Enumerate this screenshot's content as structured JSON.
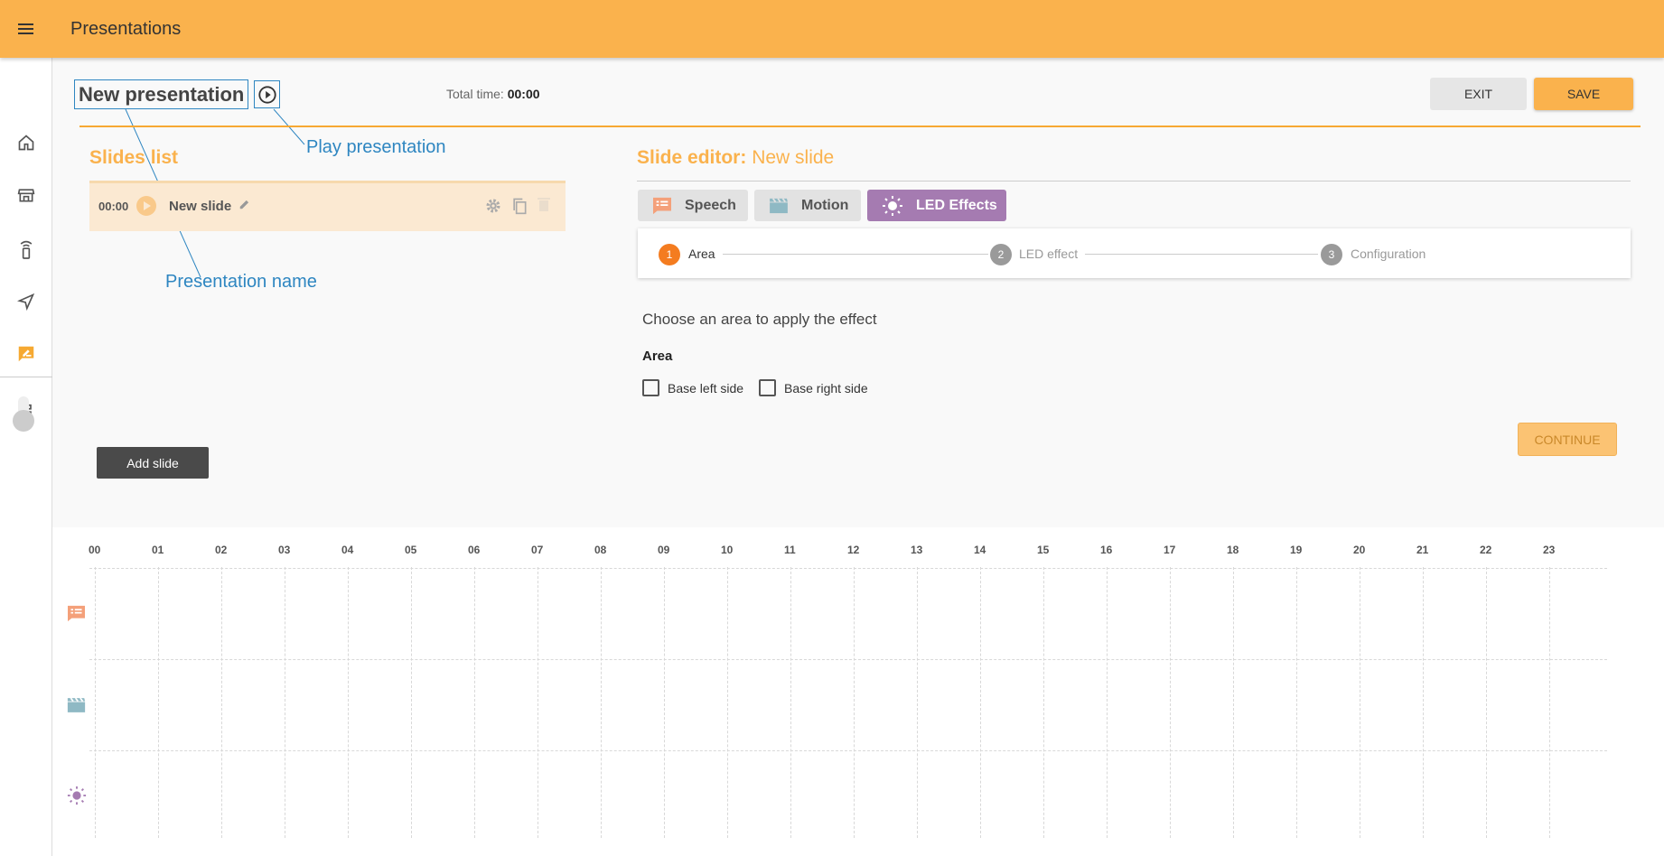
{
  "app": {
    "title": "Presentations"
  },
  "sidebar": {
    "items": [
      {
        "name": "home",
        "icon": "home-icon"
      },
      {
        "name": "store",
        "icon": "store-icon"
      },
      {
        "name": "remote",
        "icon": "remote-icon"
      },
      {
        "name": "navigation",
        "icon": "send-icon"
      },
      {
        "name": "presentations",
        "icon": "presentation-icon",
        "active": true
      },
      {
        "name": "extensions",
        "icon": "puzzle-icon"
      }
    ]
  },
  "presentation": {
    "name": "New presentation",
    "total_time_label": "Total time:",
    "total_time_value": "00:00"
  },
  "annotations": {
    "play": "Play presentation",
    "name": "Presentation name"
  },
  "actions": {
    "exit": "EXIT",
    "save": "SAVE"
  },
  "slides": {
    "title": "Slides list",
    "items": [
      {
        "time": "00:00",
        "name": "New slide"
      }
    ],
    "add_label": "Add slide"
  },
  "editor": {
    "title_prefix": "Slide editor:",
    "slide_name": "New slide",
    "tabs": [
      {
        "label": "Speech",
        "icon": "speech-icon"
      },
      {
        "label": "Motion",
        "icon": "clapperboard-icon"
      },
      {
        "label": "LED Effects",
        "icon": "sun-icon",
        "active": true
      }
    ],
    "steps": [
      {
        "num": "1",
        "label": "Area",
        "active": true
      },
      {
        "num": "2",
        "label": "LED effect"
      },
      {
        "num": "3",
        "label": "Configuration"
      }
    ],
    "instruction": "Choose an area to apply the effect",
    "area_label": "Area",
    "options": [
      {
        "label": "Base left side",
        "checked": false
      },
      {
        "label": "Base right side",
        "checked": false
      }
    ],
    "continue_label": "CONTINUE"
  },
  "timeline": {
    "hours": [
      "00",
      "01",
      "02",
      "03",
      "04",
      "05",
      "06",
      "07",
      "08",
      "09",
      "10",
      "11",
      "12",
      "13",
      "14",
      "15",
      "16",
      "17",
      "18",
      "19",
      "20",
      "21",
      "22",
      "23"
    ],
    "rows": [
      {
        "name": "speech",
        "icon": "speech-icon",
        "color": "#f4a07a"
      },
      {
        "name": "motion",
        "icon": "clapperboard-icon",
        "color": "#8fb9c4"
      },
      {
        "name": "led",
        "icon": "sun-icon",
        "color": "#a57bb1"
      }
    ]
  },
  "colors": {
    "accent": "#fab24d",
    "annotation": "#2e86c1",
    "led": "#a57bb1",
    "active_step": "#f47c20"
  }
}
